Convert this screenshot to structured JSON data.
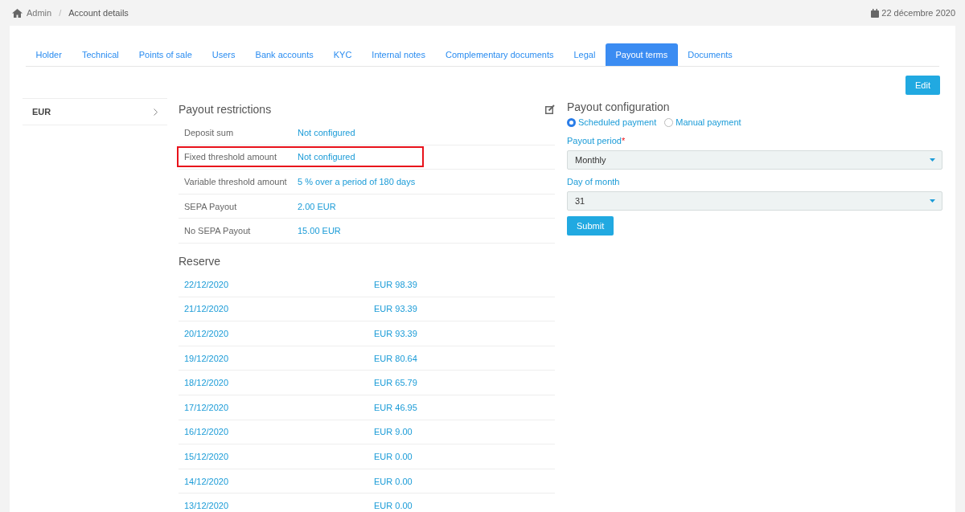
{
  "breadcrumb": [
    {
      "label": "Admin"
    },
    {
      "label": "Account details"
    }
  ],
  "breadcrumb_separator": "/",
  "date": "22 décembre 2020",
  "tabs": [
    {
      "label": "Holder",
      "selected": false
    },
    {
      "label": "Technical",
      "selected": false
    },
    {
      "label": "Points of sale",
      "selected": false
    },
    {
      "label": "Users",
      "selected": false
    },
    {
      "label": "Bank accounts",
      "selected": false
    },
    {
      "label": "KYC",
      "selected": false
    },
    {
      "label": "Internal notes",
      "selected": false
    },
    {
      "label": "Complementary documents",
      "selected": false
    },
    {
      "label": "Legal",
      "selected": false
    },
    {
      "label": "Payout terms",
      "selected": true
    },
    {
      "label": "Documents",
      "selected": false
    }
  ],
  "edit_button": "Edit",
  "currencies": [
    {
      "label": "EUR"
    }
  ],
  "payout_restrictions": {
    "title": "Payout restrictions",
    "rows": [
      {
        "label": "Deposit sum",
        "value": "Not configured",
        "highlighted": false
      },
      {
        "label": "Fixed threshold amount",
        "value": "Not configured",
        "highlighted": true
      },
      {
        "label": "Variable threshold amount",
        "value": "5 % over a period of 180 days",
        "highlighted": false
      },
      {
        "label": "SEPA Payout",
        "value": "2.00 EUR",
        "highlighted": false
      },
      {
        "label": "No SEPA Payout",
        "value": "15.00 EUR",
        "highlighted": false
      }
    ]
  },
  "reserve": {
    "title": "Reserve",
    "rows": [
      {
        "date": "22/12/2020",
        "amount": "EUR 98.39"
      },
      {
        "date": "21/12/2020",
        "amount": "EUR 93.39"
      },
      {
        "date": "20/12/2020",
        "amount": "EUR 93.39"
      },
      {
        "date": "19/12/2020",
        "amount": "EUR 80.64"
      },
      {
        "date": "18/12/2020",
        "amount": "EUR 65.79"
      },
      {
        "date": "17/12/2020",
        "amount": "EUR 46.95"
      },
      {
        "date": "16/12/2020",
        "amount": "EUR 9.00"
      },
      {
        "date": "15/12/2020",
        "amount": "EUR 0.00"
      },
      {
        "date": "14/12/2020",
        "amount": "EUR 0.00"
      },
      {
        "date": "13/12/2020",
        "amount": "EUR 0.00"
      }
    ]
  },
  "payout_configuration": {
    "title": "Payout configuration",
    "payment_types": [
      {
        "label": "Scheduled payment",
        "selected": true
      },
      {
        "label": "Manual payment",
        "selected": false
      }
    ],
    "fields": [
      {
        "label": "Payout period",
        "required": true,
        "value": "Monthly"
      },
      {
        "label": "Day of month",
        "required": false,
        "value": "31"
      }
    ],
    "required_mark": "*",
    "submit": "Submit"
  }
}
